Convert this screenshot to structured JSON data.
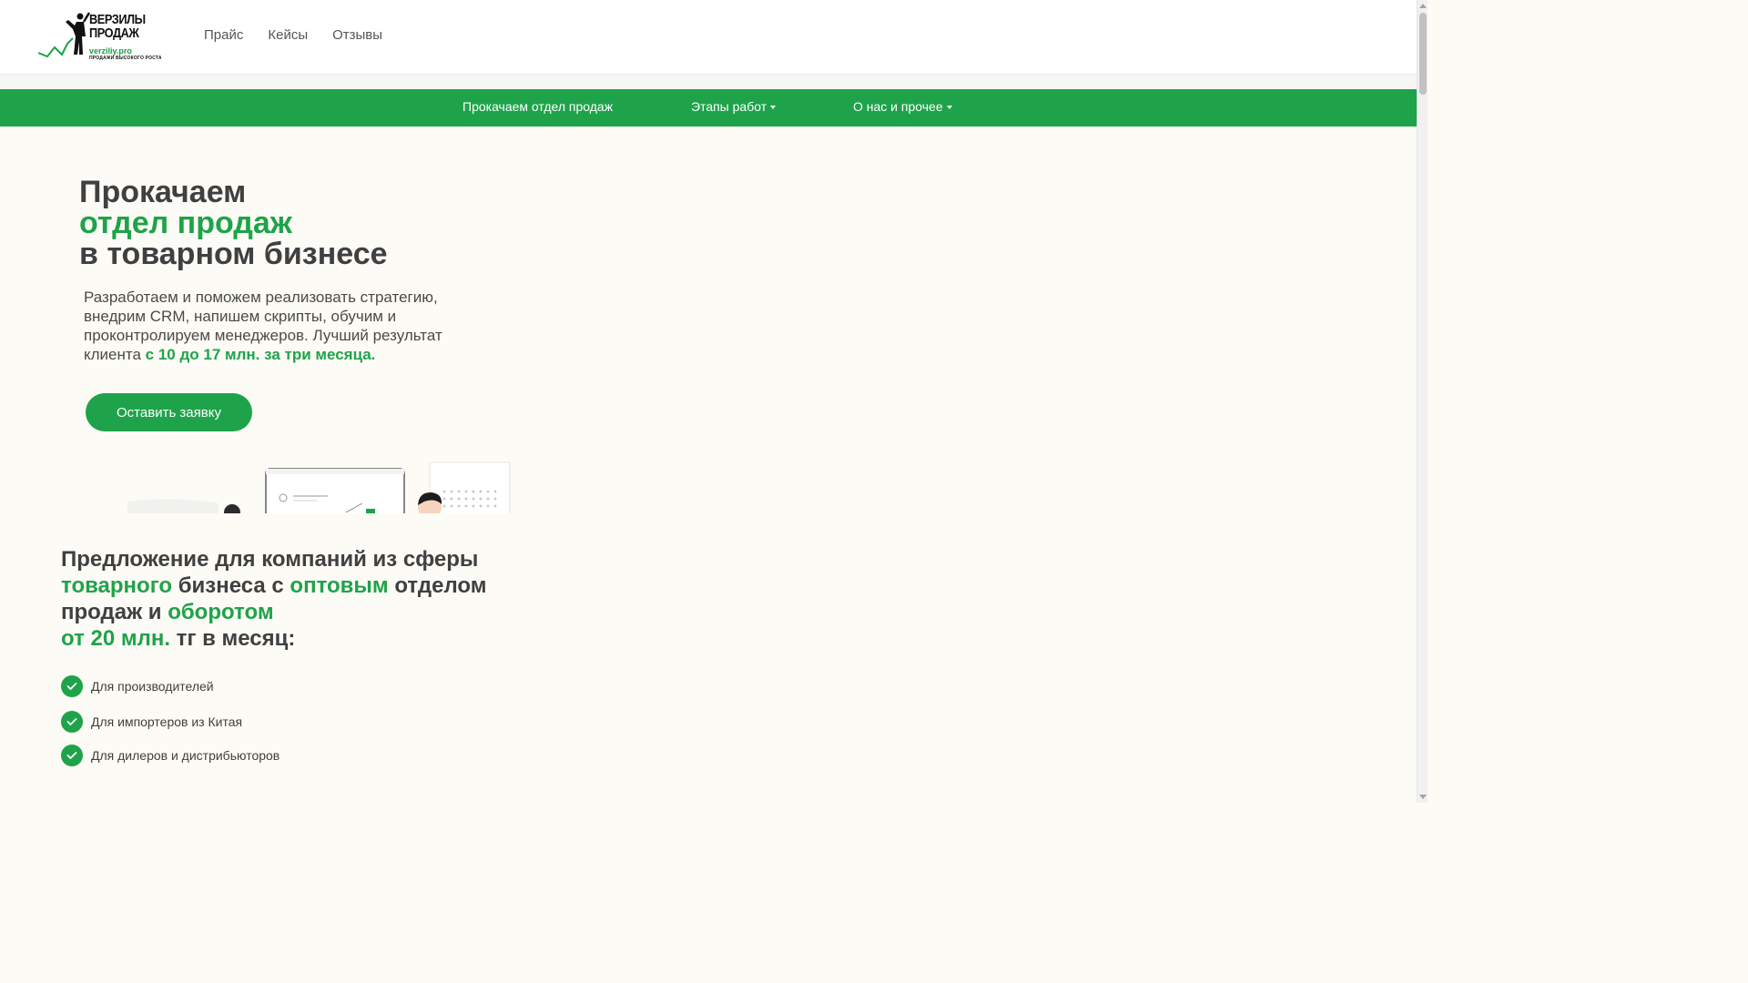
{
  "brand": {
    "name": "ВЕРЗИЛЫ ПРОДАЖ",
    "site": "verziliy.pro",
    "tagline": "ПРОДАЖИ ВЫСОКОГО РОСТА",
    "accent": "#1fa34a"
  },
  "top_nav": [
    {
      "label": "Прайс"
    },
    {
      "label": "Кейсы"
    },
    {
      "label": "Отзывы"
    }
  ],
  "main_nav": [
    {
      "label": "Прокачаем отдел продаж",
      "has_dropdown": false
    },
    {
      "label": "Этапы работ",
      "has_dropdown": true
    },
    {
      "label": "О нас и прочее",
      "has_dropdown": true
    }
  ],
  "hero": {
    "title_line1": "Прокачаем",
    "title_line2": "отдел продаж",
    "title_line3": "в товарном бизнесе",
    "text": "Разработаем и поможем реализовать стратегию, внедрим CRM, напишем скрипты, обучим и проконтролируем менеджеров. Лучший результат клиента ",
    "text_highlight": "с 10 до 17 млн. за три месяца.",
    "cta_label": "Оставить заявку"
  },
  "offer": {
    "p1": "Предложение для компаний из сферы ",
    "g1": "товарного",
    "p2": " бизнеса с ",
    "g2": "оптовым",
    "p3": " отделом продаж и ",
    "g3": "оборотом",
    "g4": "от 20 млн.",
    "p4": " тг в месяц:",
    "items": [
      {
        "label": "Для производителей",
        "icon": "check-icon"
      },
      {
        "label": "Для импортеров из Китая",
        "icon": "check-icon"
      },
      {
        "label": "Для дилеров и дистрибьюторов",
        "icon": "check-icon"
      }
    ]
  }
}
